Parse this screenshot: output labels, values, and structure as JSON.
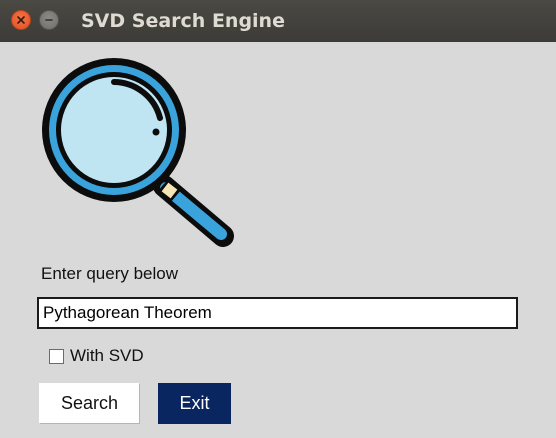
{
  "window": {
    "title": "SVD Search Engine",
    "controls": [
      "close-icon",
      "minimize-icon"
    ]
  },
  "logo": {
    "icon": "magnifying-glass-icon",
    "colors": {
      "lens": "#bfe5f2",
      "ring": "#3aa3dc",
      "outline": "#0c0c0c",
      "handle": "#3aa3dc",
      "collar": "#f3e5b6"
    }
  },
  "query": {
    "label": "Enter query below",
    "value": "Pythagorean Theorem"
  },
  "options": {
    "svd_label": "With SVD",
    "svd_checked": false
  },
  "buttons": {
    "search_label": "Search",
    "exit_label": "Exit",
    "exit_color": "#0a2660"
  }
}
